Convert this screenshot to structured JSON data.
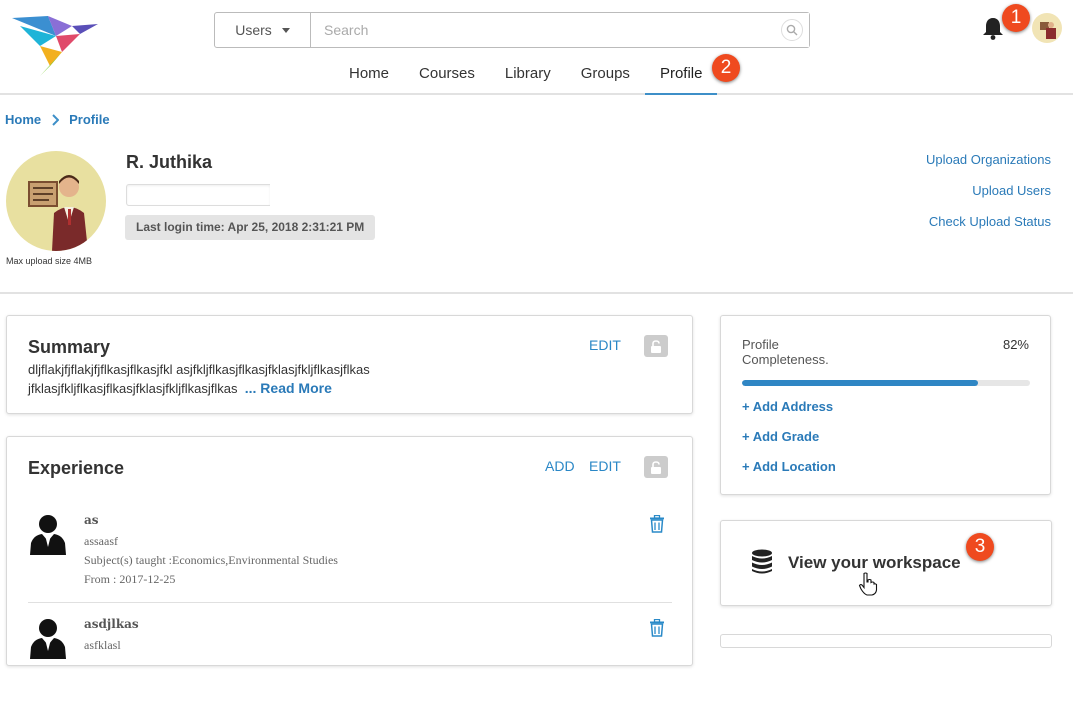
{
  "header": {
    "search": {
      "scope": "Users",
      "placeholder": "Search"
    },
    "nav_tabs": [
      "Home",
      "Courses",
      "Library",
      "Groups",
      "Profile"
    ],
    "active_tab": "Profile",
    "markers": [
      "1",
      "2",
      "3"
    ]
  },
  "breadcrumb": {
    "home": "Home",
    "current": "Profile"
  },
  "profile": {
    "name": "R. Juthika",
    "last_login": "Last login time: Apr 25, 2018 2:31:21 PM",
    "upload_note": "Max upload size 4MB"
  },
  "upload_links": [
    "Upload Organizations",
    "Upload Users",
    "Check Upload Status"
  ],
  "summary": {
    "title": "Summary",
    "edit": "EDIT",
    "text": "dljflakjfjflakjfjflkasjflkasjfkl asjfkljflkasjflkasjfklasjfkljflkasjflkas jfklasjfkljflkasjflkasjfklasjfkljflkasjflkas",
    "read_more": "... Read More"
  },
  "experience": {
    "title": "Experience",
    "add": "ADD",
    "edit": "EDIT",
    "items": [
      {
        "title": "as",
        "org": "assaasf",
        "subjects": "Subject(s) taught :Economics,Environmental Studies",
        "from": "From : 2017-12-25"
      },
      {
        "title": "asdjlkas",
        "org": "asfklasl"
      }
    ]
  },
  "completeness": {
    "label_line1": "Profile",
    "label_line2": "Completeness.",
    "percent_text": "82%",
    "value": 0.82,
    "actions": [
      "+ Add Address",
      "+ Add Grade",
      "+ Add Location"
    ]
  },
  "workspace": {
    "label": "View your workspace"
  },
  "colors": {
    "accent": "#2a7ab8",
    "marker": "#ef4a1f"
  }
}
